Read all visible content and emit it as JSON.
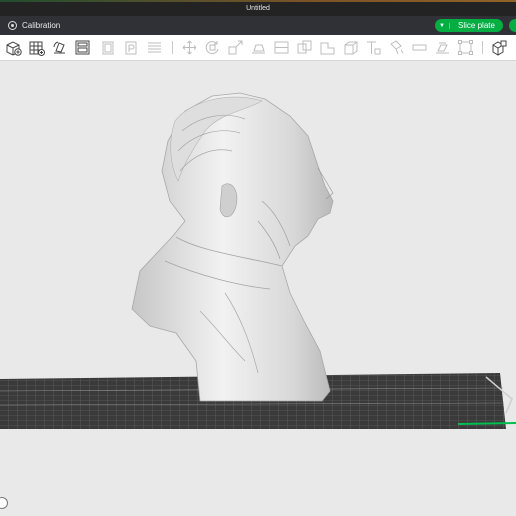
{
  "window": {
    "title": "Untitled"
  },
  "tabbar": {
    "calibration_label": "Calibration",
    "slice_button_label": "Slice plate"
  },
  "toolbar": {
    "tools": [
      "add-object-icon",
      "add-plate-icon",
      "auto-orient-icon",
      "arrange-icon",
      "plate-gallery-icon",
      "plate-settings-icon",
      "layers-icon",
      "move-icon",
      "rotate-icon",
      "scale-icon",
      "lay-on-face-icon",
      "split-objects-icon",
      "split-parts-icon",
      "variable-layer-height-icon",
      "cut-icon",
      "boolean-icon",
      "text-icon",
      "paint-support-icon",
      "seam-painting-icon",
      "measure-icon",
      "assembly-icon",
      "view-icon"
    ]
  },
  "colors": {
    "accent": "#00ae42",
    "titlebar": "#232323",
    "tabbar": "#2f3136",
    "viewport": "#e9e9e9"
  }
}
